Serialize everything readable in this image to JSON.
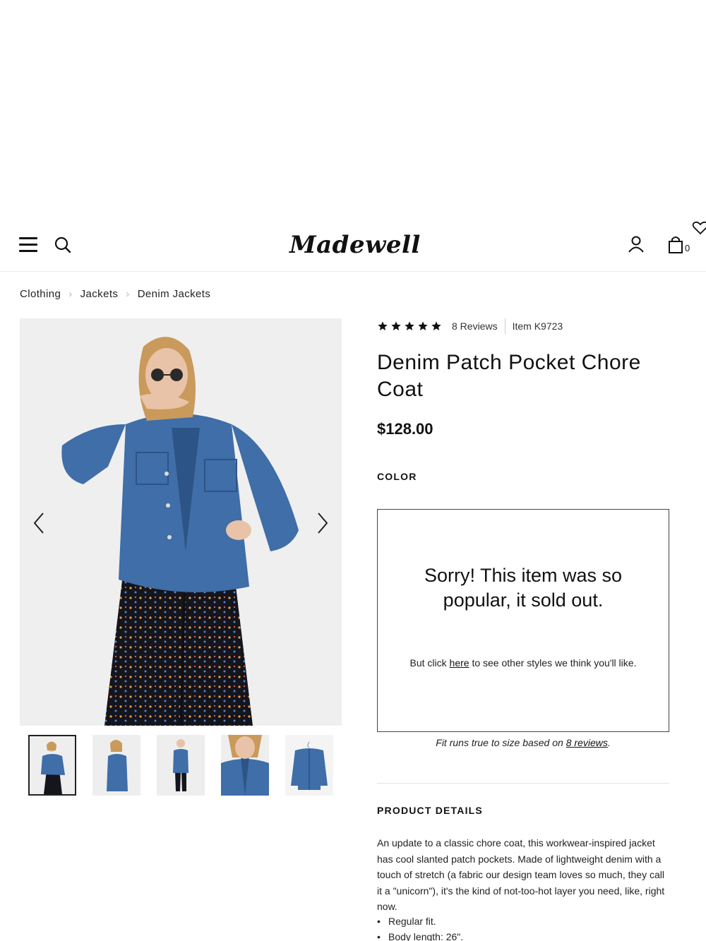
{
  "header": {
    "logo_text": "Madewell",
    "bag_count": "0"
  },
  "breadcrumb": [
    "Clothing",
    "Jackets",
    "Denim Jackets"
  ],
  "product": {
    "reviews_label": "8 Reviews",
    "item_number": "Item K9723",
    "title": "Denim Patch Pocket Chore Coat",
    "price": "$128.00",
    "color_label": "COLOR",
    "rating_stars": 5
  },
  "soldout": {
    "headline": "Sorry! This item was so popular, it sold out.",
    "sub_before": "But click ",
    "sub_link": "here",
    "sub_after": " to see other styles we think you'll like."
  },
  "fit_note": {
    "prefix": "Fit runs true to size based on ",
    "link": "8 reviews",
    "suffix": "."
  },
  "details": {
    "heading": "PRODUCT DETAILS",
    "body": "An update to a classic chore coat, this workwear-inspired jacket has cool slanted patch pockets. Made of lightweight denim with a touch of stretch (a fabric our design team loves so much, they call it a \"unicorn\"), it's the kind of not-too-hot layer you need, like, right now.",
    "bullets": [
      "Regular fit.",
      "Body length: 26\"."
    ]
  },
  "colors": {
    "denim": "#3f6ea8",
    "denim_dark": "#2d5486",
    "pants": "#15151d",
    "skin": "#e9c3a8",
    "hair": "#c99a5b"
  }
}
